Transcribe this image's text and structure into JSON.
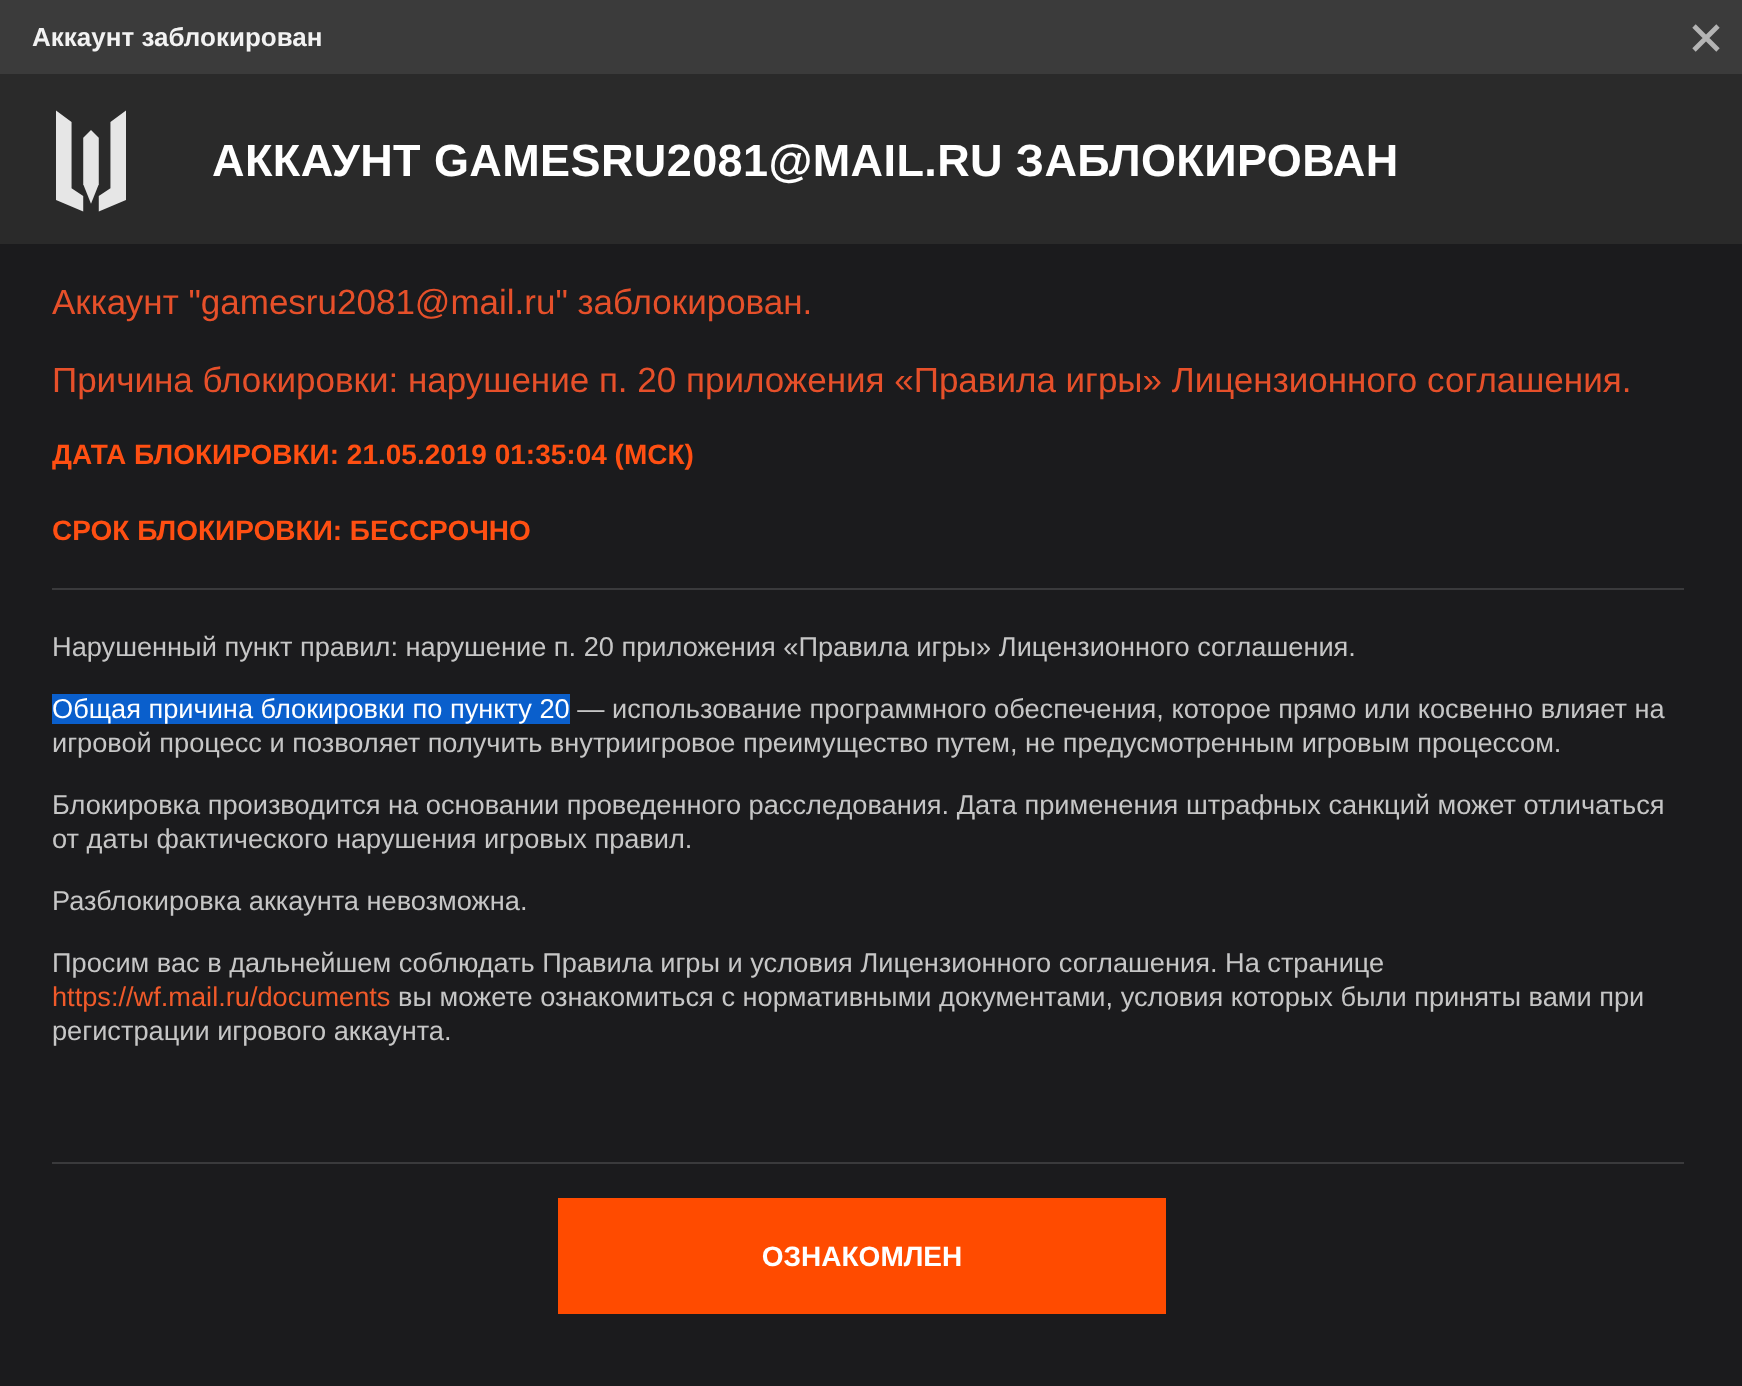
{
  "window": {
    "title": "Аккаунт заблокирован"
  },
  "header": {
    "title": "АККАУНТ GAMESRU2081@MAIL.RU ЗАБЛОКИРОВАН"
  },
  "notices": [
    {
      "kind": "message",
      "text": "Аккаунт \"gamesru2081@mail.ru\" заблокирован."
    },
    {
      "kind": "message",
      "text": "Причина блокировки: нарушение п. 20 приложения «Правила игры» Лицензионного соглашения."
    },
    {
      "kind": "fact",
      "text": "ДАТА БЛОКИРОВКИ: 21.05.2019 01:35:04 (МСК)"
    },
    {
      "kind": "fact",
      "text": "СРОК БЛОКИРОВКИ: БЕССРОЧНО"
    }
  ],
  "paragraphs": [
    {
      "parts": [
        {
          "kind": "text",
          "text": "Нарушенный пункт правил: нарушение п. 20 приложения «Правила игры» Лицензионного соглашения."
        }
      ]
    },
    {
      "parts": [
        {
          "kind": "highlight",
          "text": "Общая причина блокировки по пункту 20"
        },
        {
          "kind": "text",
          "text": " — использование программного обеспечения, которое прямо или косвенно влияет на игровой процесс и позволяет получить внутриигровое преимущество путем, не предусмотренным игровым процессом."
        }
      ]
    },
    {
      "parts": [
        {
          "kind": "text",
          "text": "Блокировка производится на основании проведенного расследования. Дата применения штрафных санкций может отличаться от даты фактического нарушения игровых правил."
        }
      ]
    },
    {
      "parts": [
        {
          "kind": "text",
          "text": "Разблокировка аккаунта невозможна."
        }
      ]
    },
    {
      "parts": [
        {
          "kind": "text",
          "text": "Просим вас в дальнейшем соблюдать Правила игры и условия Лицензионного соглашения. На странице "
        },
        {
          "kind": "link",
          "text": "https://wf.mail.ru/documents"
        },
        {
          "kind": "text",
          "text": " вы можете ознакомиться с нормативными документами, условия которых были приняты вами при регистрации игрового аккаунта."
        }
      ]
    }
  ],
  "button": {
    "label": "ОЗНАКОМЛЕН"
  }
}
